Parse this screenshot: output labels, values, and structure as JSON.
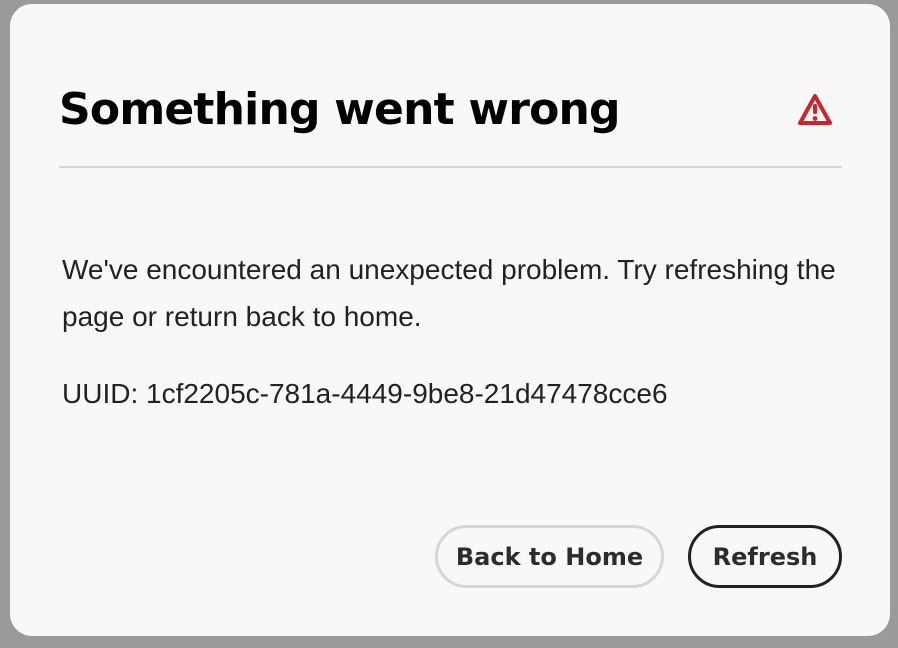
{
  "dialog": {
    "title": "Something went wrong",
    "icon": "alert-triangle-icon",
    "icon_color": "#c9252d",
    "message": "We've encountered an unexpected problem. Try refreshing the page or return back to home.",
    "uuid_text": "UUID: 1cf2205c-781a-4449-9be8-21d47478cce6"
  },
  "buttons": {
    "back_home_label": "Back to Home",
    "refresh_label": "Refresh"
  }
}
